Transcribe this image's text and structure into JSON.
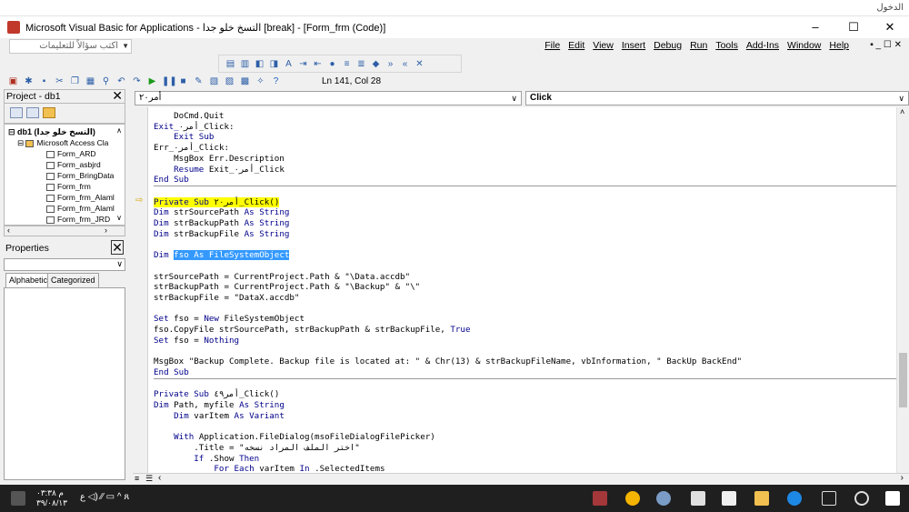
{
  "topstrip": {
    "right_text": "الدخول"
  },
  "window": {
    "title": "Microsoft Visual Basic for Applications - التسخ خلو جدا [break] - [Form_frm (Code)]",
    "minimize": "–",
    "maximize": "☐",
    "close": "✕"
  },
  "menu": {
    "items": [
      "Help",
      "Window",
      "Add-Ins",
      "Tools",
      "Run",
      "Debug",
      "Insert",
      "View",
      "Edit",
      "File"
    ],
    "help_placeholder": "اكتب سؤالاً للتعليمات"
  },
  "toolbar": {
    "position_label": "Ln 141, Col 28"
  },
  "project": {
    "title": "Project - db1",
    "root": "db1 (التسخ خلو جدا)",
    "group": "Microsoft Access Cla",
    "items": [
      "Form_ARD",
      "Form_asbjrd",
      "Form_BringData",
      "Form_frm",
      "Form_frm_Alaml",
      "Form_frm_Alaml",
      "Form_frm_JRD"
    ]
  },
  "properties": {
    "title": "Properties",
    "tab_alphabetic": "Alphabetic",
    "tab_categorized": "Categorized"
  },
  "code": {
    "object": "أمر٢٠",
    "procedure": "Click"
  },
  "colors": {
    "keyword": "#00008b",
    "highlight": "#ffff00",
    "selection": "#3399ff"
  },
  "taskbar": {
    "time": "م ٠٣:٣٨",
    "date": "٣٩/٠٨/١٣"
  }
}
